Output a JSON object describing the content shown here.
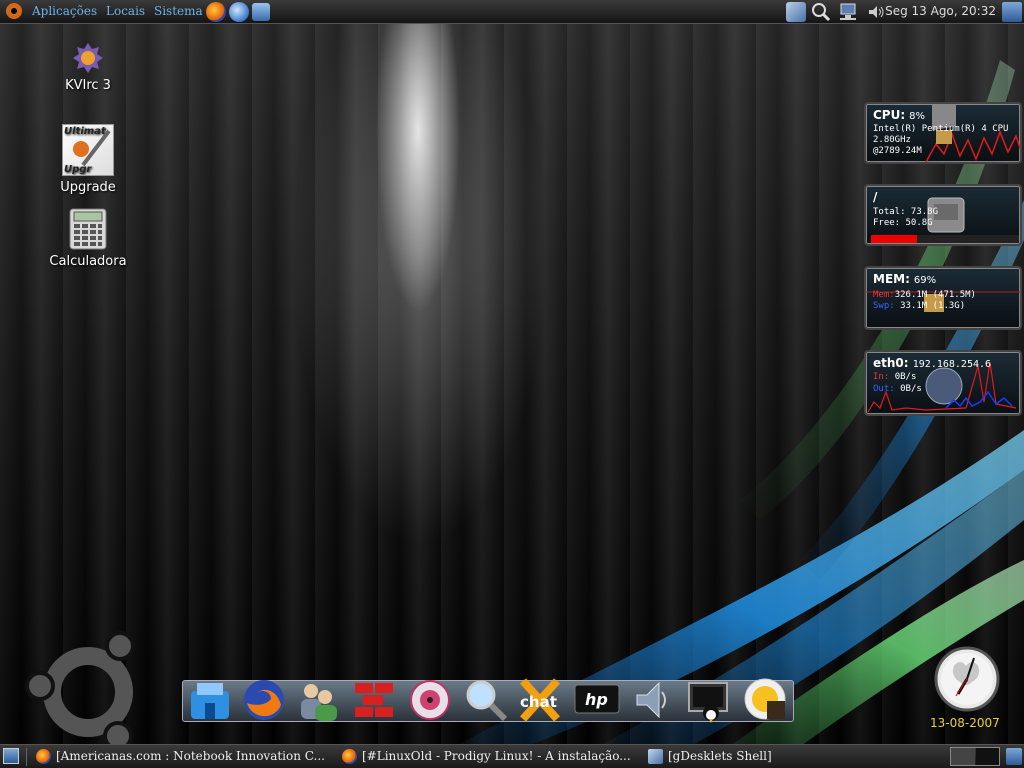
{
  "top_panel": {
    "menus": [
      "Aplicações",
      "Locais",
      "Sistema"
    ],
    "clock": "Seg 13 Ago, 20:32",
    "launchers": [
      "firefox-icon",
      "thunderbird-icon",
      "help-icon"
    ],
    "tray": [
      "network-tray-icon",
      "search-icon",
      "network-monitor-icon",
      "volume-icon",
      "user-switcher-icon"
    ]
  },
  "desktop_icons": [
    {
      "label": "KVIrc 3",
      "icon": "kvirc-icon"
    },
    {
      "label": "Upgrade",
      "icon": "ultimate-upgrade-icon"
    },
    {
      "label": "Calculadora",
      "icon": "calculator-icon"
    }
  ],
  "gdesklets": {
    "cpu": {
      "title": "CPU:",
      "value": "8%",
      "model": "Intel(R) Pentium(R) 4 CPU",
      "speed": "2.80GHz",
      "freq": "@2789.24M"
    },
    "disk": {
      "title": "/",
      "total": "Total: 73.8G",
      "free": "Free: 50.8G",
      "used_fraction": 0.31
    },
    "mem": {
      "title": "MEM:",
      "value": "69%",
      "mem_label": "Mem:",
      "mem_value": "326.1M (471.5M)",
      "swap_label": "Swp:",
      "swap_value": "33.1M (1.3G)"
    },
    "net": {
      "title": "eth0:",
      "ip": "192.168.254.6",
      "in_label": "In:",
      "in_value": "0B/s",
      "out_label": "Out:",
      "out_value": "0B/s"
    }
  },
  "dock": {
    "items": [
      "home-folder-icon",
      "firefox-icon",
      "users-icon",
      "firewall-icon",
      "cd-burner-icon",
      "search-icon",
      "xchat-icon",
      "hp-icon",
      "sound-icon",
      "terminal-icon",
      "media-player-icon"
    ]
  },
  "clock_widget": {
    "date": "13-08-2007"
  },
  "taskbar": {
    "tasks": [
      {
        "label": "[Americanas.com : Notebook Innovation C...",
        "icon": "firefox-icon"
      },
      {
        "label": "[#LinuxOld - Prodigy Linux! - A instalação...",
        "icon": "firefox-icon"
      },
      {
        "label": "[gDesklets Shell]",
        "icon": "gdesklets-icon"
      }
    ]
  },
  "colors": {
    "menu_text": "#6fb2e8",
    "date_text": "#e6d23a",
    "ubuntu_orange": "#d56a1a"
  }
}
